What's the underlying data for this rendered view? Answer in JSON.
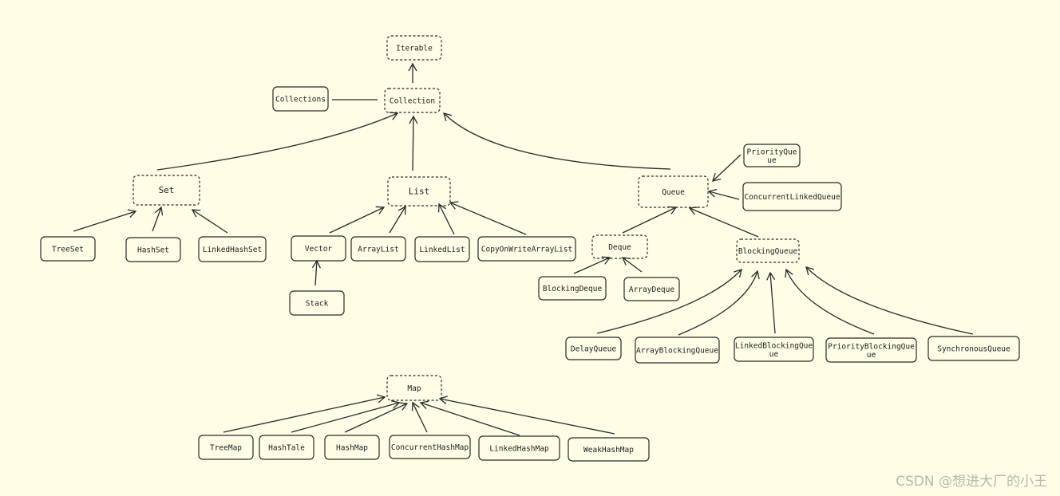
{
  "colors": {
    "background": "#fefde6",
    "stroke": "#2b2b2b",
    "text": "#1e1e1e",
    "watermark": "#b8b8b0"
  },
  "legend_note": {
    "dashed_border": "interface",
    "solid_border": "class"
  },
  "nodes": [
    {
      "id": "iterable",
      "label": "Iterable",
      "dashed": true
    },
    {
      "id": "collection",
      "label": "Collection",
      "dashed": true
    },
    {
      "id": "collections",
      "label": "Collections",
      "dashed": false
    },
    {
      "id": "set",
      "label": "Set",
      "dashed": true
    },
    {
      "id": "list",
      "label": "List",
      "dashed": true
    },
    {
      "id": "queue",
      "label": "Queue",
      "dashed": true
    },
    {
      "id": "priorityqueue",
      "label": "PriorityQue\nue",
      "dashed": false
    },
    {
      "id": "concurrentlinkedqueue",
      "label": "ConcurrentLinkedQueue",
      "dashed": false
    },
    {
      "id": "treeset",
      "label": "TreeSet",
      "dashed": false
    },
    {
      "id": "hashset",
      "label": "HashSet",
      "dashed": false
    },
    {
      "id": "linkedhashset",
      "label": "LinkedHashSet",
      "dashed": false
    },
    {
      "id": "vector",
      "label": "Vector",
      "dashed": false
    },
    {
      "id": "arraylist",
      "label": "ArrayList",
      "dashed": false
    },
    {
      "id": "linkedlist",
      "label": "LinkedList",
      "dashed": false
    },
    {
      "id": "copyonwritearraylist",
      "label": "CopyOnWriteArrayList",
      "dashed": false
    },
    {
      "id": "stack",
      "label": "Stack",
      "dashed": false
    },
    {
      "id": "deque",
      "label": "Deque",
      "dashed": true
    },
    {
      "id": "blockingqueue",
      "label": "BlockingQueue",
      "dashed": true
    },
    {
      "id": "blockingdeque",
      "label": "BlockingDeque",
      "dashed": false
    },
    {
      "id": "arraydeque",
      "label": "ArrayDeque",
      "dashed": false
    },
    {
      "id": "delayqueue",
      "label": "DelayQueue",
      "dashed": false
    },
    {
      "id": "arrayblockingqueue",
      "label": "ArrayBlockingQueue",
      "dashed": false
    },
    {
      "id": "linkedblockingqueue",
      "label": "LinkedBlockingQue\nue",
      "dashed": false
    },
    {
      "id": "priorityblockingqueue",
      "label": "PriorityBlockingQue\nue",
      "dashed": false
    },
    {
      "id": "synchronousqueue",
      "label": "SynchronousQueue",
      "dashed": false
    },
    {
      "id": "map",
      "label": "Map",
      "dashed": true
    },
    {
      "id": "treemap",
      "label": "TreeMap",
      "dashed": false
    },
    {
      "id": "hashtale",
      "label": "HashTale",
      "dashed": false
    },
    {
      "id": "hashmap",
      "label": "HashMap",
      "dashed": false
    },
    {
      "id": "concurrenthashmap",
      "label": "ConcurrentHashMap",
      "dashed": false
    },
    {
      "id": "linkedhashmap",
      "label": "LinkedHashMap",
      "dashed": false
    },
    {
      "id": "weakhashmap",
      "label": "WeakHashMap",
      "dashed": false
    }
  ],
  "edges": [
    {
      "from": "collection",
      "to": "iterable",
      "arrow": true
    },
    {
      "from": "collections",
      "to": "collection",
      "arrow": false
    },
    {
      "from": "set",
      "to": "collection",
      "arrow": true
    },
    {
      "from": "list",
      "to": "collection",
      "arrow": true
    },
    {
      "from": "queue",
      "to": "collection",
      "arrow": true
    },
    {
      "from": "priorityqueue",
      "to": "queue",
      "arrow": true
    },
    {
      "from": "concurrentlinkedqueue",
      "to": "queue",
      "arrow": true
    },
    {
      "from": "treeset",
      "to": "set",
      "arrow": true
    },
    {
      "from": "hashset",
      "to": "set",
      "arrow": true
    },
    {
      "from": "linkedhashset",
      "to": "set",
      "arrow": true
    },
    {
      "from": "vector",
      "to": "list",
      "arrow": true
    },
    {
      "from": "arraylist",
      "to": "list",
      "arrow": true
    },
    {
      "from": "linkedlist",
      "to": "list",
      "arrow": true
    },
    {
      "from": "copyonwritearraylist",
      "to": "list",
      "arrow": true
    },
    {
      "from": "stack",
      "to": "vector",
      "arrow": true
    },
    {
      "from": "deque",
      "to": "queue",
      "arrow": true
    },
    {
      "from": "blockingqueue",
      "to": "queue",
      "arrow": true
    },
    {
      "from": "blockingdeque",
      "to": "deque",
      "arrow": true
    },
    {
      "from": "arraydeque",
      "to": "deque",
      "arrow": true
    },
    {
      "from": "delayqueue",
      "to": "blockingqueue",
      "arrow": true
    },
    {
      "from": "arrayblockingqueue",
      "to": "blockingqueue",
      "arrow": true
    },
    {
      "from": "linkedblockingqueue",
      "to": "blockingqueue",
      "arrow": true
    },
    {
      "from": "priorityblockingqueue",
      "to": "blockingqueue",
      "arrow": true
    },
    {
      "from": "synchronousqueue",
      "to": "blockingqueue",
      "arrow": true
    },
    {
      "from": "treemap",
      "to": "map",
      "arrow": true
    },
    {
      "from": "hashtale",
      "to": "map",
      "arrow": true
    },
    {
      "from": "hashmap",
      "to": "map",
      "arrow": true
    },
    {
      "from": "concurrenthashmap",
      "to": "map",
      "arrow": true
    },
    {
      "from": "linkedhashmap",
      "to": "map",
      "arrow": true
    },
    {
      "from": "weakhashmap",
      "to": "map",
      "arrow": true
    }
  ],
  "watermark": "CSDN @想进大厂的小王"
}
